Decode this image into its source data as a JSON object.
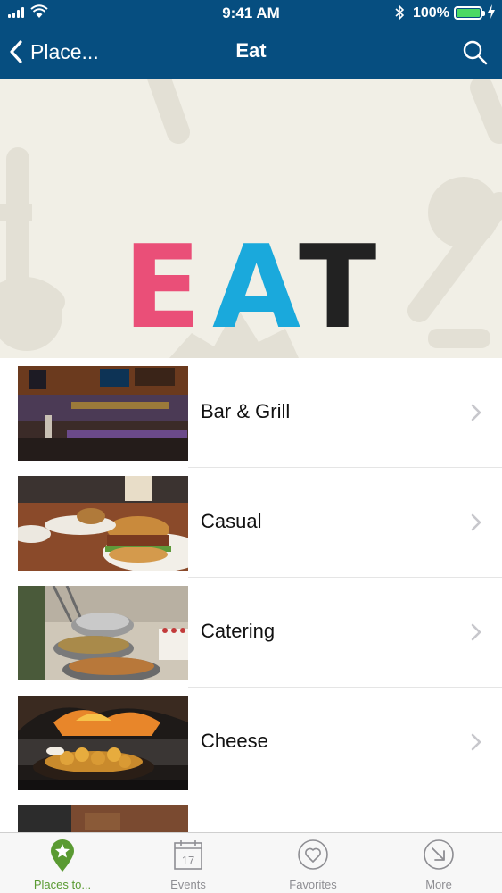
{
  "status_bar": {
    "time": "9:41 AM",
    "battery_percent": "100%"
  },
  "nav": {
    "back_label": "Place...",
    "title": "Eat"
  },
  "banner": {
    "letters": [
      "E",
      "A",
      "T"
    ]
  },
  "list": [
    {
      "label": "Bar & Grill"
    },
    {
      "label": "Casual"
    },
    {
      "label": "Catering"
    },
    {
      "label": "Cheese"
    },
    {
      "label": ""
    }
  ],
  "tabs": [
    {
      "label": "Places to...",
      "icon": "star-pin-icon",
      "active": true
    },
    {
      "label": "Events",
      "icon": "calendar-icon",
      "date": "17"
    },
    {
      "label": "Favorites",
      "icon": "heart-icon"
    },
    {
      "label": "More",
      "icon": "more-arrow-icon"
    }
  ],
  "colors": {
    "nav_bg": "#064e80",
    "tab_active": "#5a9a32",
    "e": "#ea4f78",
    "a": "#1aa9dc",
    "t": "#222222"
  }
}
